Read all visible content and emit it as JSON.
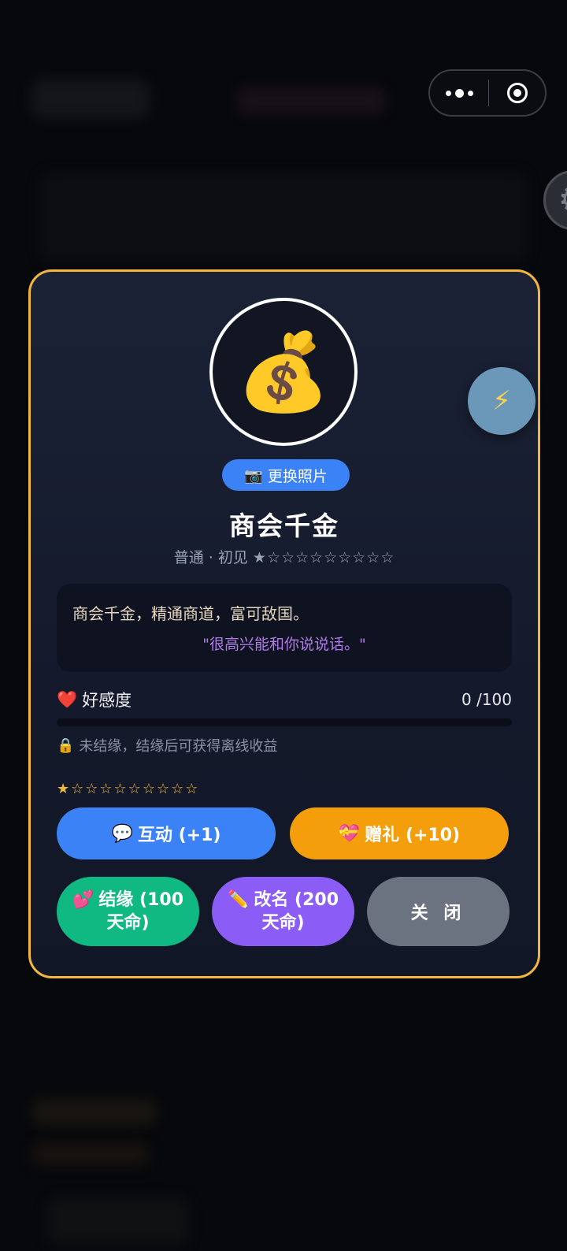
{
  "character": {
    "avatar_icon": "money-bag",
    "photo_button": {
      "icon": "camera",
      "label": "更换照片"
    },
    "name": "商会千金",
    "meta": "普通 · 初见",
    "meta_stars": "★☆☆☆☆☆☆☆☆☆",
    "description": "商会千金，精通商道，富可敌国。",
    "quote": "\"很高兴能和你说说话。\""
  },
  "affection": {
    "icon": "heart",
    "label": "好感度",
    "value": "0 /100",
    "fill": 0
  },
  "bond_note": {
    "icon": "lock",
    "text": "未结缘，结缘后可获得离线收益"
  },
  "rank_stars": "★☆☆☆☆☆☆☆☆☆",
  "buttons": {
    "interact": {
      "icon": "speech-bubble",
      "label": "互动 (+1)"
    },
    "gift": {
      "icon": "gift-heart",
      "label": "赠礼 (+10)"
    },
    "bond": {
      "icon": "two-hearts",
      "label": "结缘 (100天命)"
    },
    "rename": {
      "icon": "pencil",
      "label": "改名 (200天命)"
    },
    "close": {
      "label": "关 闭"
    }
  },
  "fab": {
    "icon": "lightning"
  },
  "colors": {
    "modal_border": "#f2b83a",
    "interact": "#3b82f6",
    "gift": "#f59e0b",
    "bond": "#10b981",
    "rename": "#8b5cf6",
    "close": "#6b7280",
    "quote": "#b07de6"
  }
}
